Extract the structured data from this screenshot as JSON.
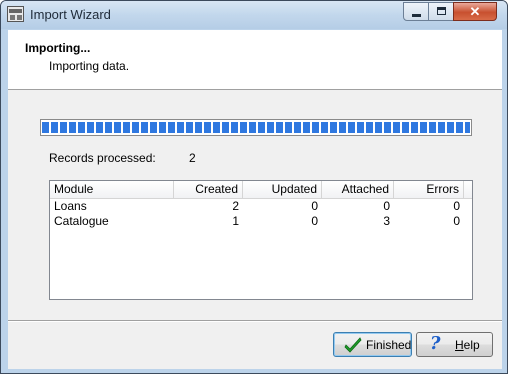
{
  "window": {
    "title": "Import Wizard"
  },
  "header": {
    "title": "Importing...",
    "subtitle": "Importing data."
  },
  "progress": {
    "percent": 100
  },
  "records": {
    "label": "Records processed:",
    "value": "2"
  },
  "table": {
    "columns": [
      "Module",
      "Created",
      "Updated",
      "Attached",
      "Errors"
    ],
    "rows": [
      [
        "Loans",
        "2",
        "0",
        "0",
        "0"
      ],
      [
        "Catalogue",
        "1",
        "0",
        "3",
        "0"
      ]
    ]
  },
  "buttons": {
    "finished": {
      "label": "Finished",
      "icon": "checkmark-icon"
    },
    "help": {
      "label_underlined": "H",
      "label_rest": "elp",
      "icon": "help-question-icon"
    }
  },
  "colors": {
    "progress": "#2f78e0",
    "check": "#1f9d2a",
    "help": "#1d5fc9"
  }
}
